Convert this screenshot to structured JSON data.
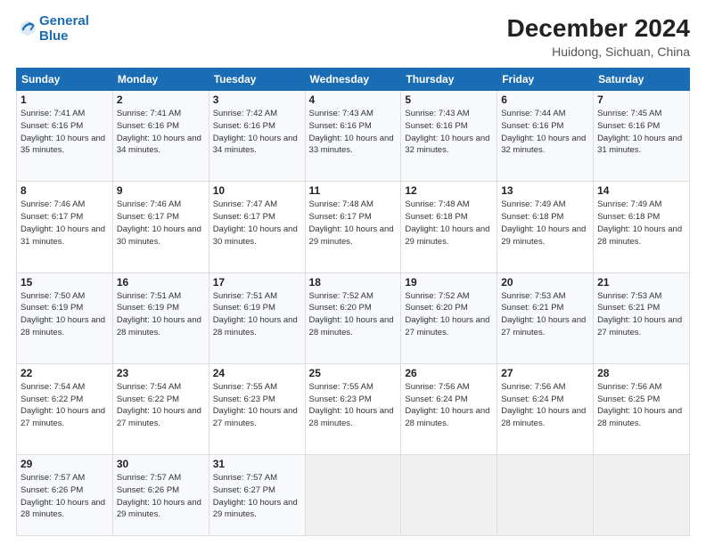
{
  "header": {
    "logo_line1": "General",
    "logo_line2": "Blue",
    "month_year": "December 2024",
    "location": "Huidong, Sichuan, China"
  },
  "weekdays": [
    "Sunday",
    "Monday",
    "Tuesday",
    "Wednesday",
    "Thursday",
    "Friday",
    "Saturday"
  ],
  "weeks": [
    [
      {
        "day": "1",
        "sunrise": "7:41 AM",
        "sunset": "6:16 PM",
        "daylight": "10 hours and 35 minutes."
      },
      {
        "day": "2",
        "sunrise": "7:41 AM",
        "sunset": "6:16 PM",
        "daylight": "10 hours and 34 minutes."
      },
      {
        "day": "3",
        "sunrise": "7:42 AM",
        "sunset": "6:16 PM",
        "daylight": "10 hours and 34 minutes."
      },
      {
        "day": "4",
        "sunrise": "7:43 AM",
        "sunset": "6:16 PM",
        "daylight": "10 hours and 33 minutes."
      },
      {
        "day": "5",
        "sunrise": "7:43 AM",
        "sunset": "6:16 PM",
        "daylight": "10 hours and 32 minutes."
      },
      {
        "day": "6",
        "sunrise": "7:44 AM",
        "sunset": "6:16 PM",
        "daylight": "10 hours and 32 minutes."
      },
      {
        "day": "7",
        "sunrise": "7:45 AM",
        "sunset": "6:16 PM",
        "daylight": "10 hours and 31 minutes."
      }
    ],
    [
      {
        "day": "8",
        "sunrise": "7:46 AM",
        "sunset": "6:17 PM",
        "daylight": "10 hours and 31 minutes."
      },
      {
        "day": "9",
        "sunrise": "7:46 AM",
        "sunset": "6:17 PM",
        "daylight": "10 hours and 30 minutes."
      },
      {
        "day": "10",
        "sunrise": "7:47 AM",
        "sunset": "6:17 PM",
        "daylight": "10 hours and 30 minutes."
      },
      {
        "day": "11",
        "sunrise": "7:48 AM",
        "sunset": "6:17 PM",
        "daylight": "10 hours and 29 minutes."
      },
      {
        "day": "12",
        "sunrise": "7:48 AM",
        "sunset": "6:18 PM",
        "daylight": "10 hours and 29 minutes."
      },
      {
        "day": "13",
        "sunrise": "7:49 AM",
        "sunset": "6:18 PM",
        "daylight": "10 hours and 29 minutes."
      },
      {
        "day": "14",
        "sunrise": "7:49 AM",
        "sunset": "6:18 PM",
        "daylight": "10 hours and 28 minutes."
      }
    ],
    [
      {
        "day": "15",
        "sunrise": "7:50 AM",
        "sunset": "6:19 PM",
        "daylight": "10 hours and 28 minutes."
      },
      {
        "day": "16",
        "sunrise": "7:51 AM",
        "sunset": "6:19 PM",
        "daylight": "10 hours and 28 minutes."
      },
      {
        "day": "17",
        "sunrise": "7:51 AM",
        "sunset": "6:19 PM",
        "daylight": "10 hours and 28 minutes."
      },
      {
        "day": "18",
        "sunrise": "7:52 AM",
        "sunset": "6:20 PM",
        "daylight": "10 hours and 28 minutes."
      },
      {
        "day": "19",
        "sunrise": "7:52 AM",
        "sunset": "6:20 PM",
        "daylight": "10 hours and 27 minutes."
      },
      {
        "day": "20",
        "sunrise": "7:53 AM",
        "sunset": "6:21 PM",
        "daylight": "10 hours and 27 minutes."
      },
      {
        "day": "21",
        "sunrise": "7:53 AM",
        "sunset": "6:21 PM",
        "daylight": "10 hours and 27 minutes."
      }
    ],
    [
      {
        "day": "22",
        "sunrise": "7:54 AM",
        "sunset": "6:22 PM",
        "daylight": "10 hours and 27 minutes."
      },
      {
        "day": "23",
        "sunrise": "7:54 AM",
        "sunset": "6:22 PM",
        "daylight": "10 hours and 27 minutes."
      },
      {
        "day": "24",
        "sunrise": "7:55 AM",
        "sunset": "6:23 PM",
        "daylight": "10 hours and 27 minutes."
      },
      {
        "day": "25",
        "sunrise": "7:55 AM",
        "sunset": "6:23 PM",
        "daylight": "10 hours and 28 minutes."
      },
      {
        "day": "26",
        "sunrise": "7:56 AM",
        "sunset": "6:24 PM",
        "daylight": "10 hours and 28 minutes."
      },
      {
        "day": "27",
        "sunrise": "7:56 AM",
        "sunset": "6:24 PM",
        "daylight": "10 hours and 28 minutes."
      },
      {
        "day": "28",
        "sunrise": "7:56 AM",
        "sunset": "6:25 PM",
        "daylight": "10 hours and 28 minutes."
      }
    ],
    [
      {
        "day": "29",
        "sunrise": "7:57 AM",
        "sunset": "6:26 PM",
        "daylight": "10 hours and 28 minutes."
      },
      {
        "day": "30",
        "sunrise": "7:57 AM",
        "sunset": "6:26 PM",
        "daylight": "10 hours and 29 minutes."
      },
      {
        "day": "31",
        "sunrise": "7:57 AM",
        "sunset": "6:27 PM",
        "daylight": "10 hours and 29 minutes."
      },
      null,
      null,
      null,
      null
    ]
  ]
}
